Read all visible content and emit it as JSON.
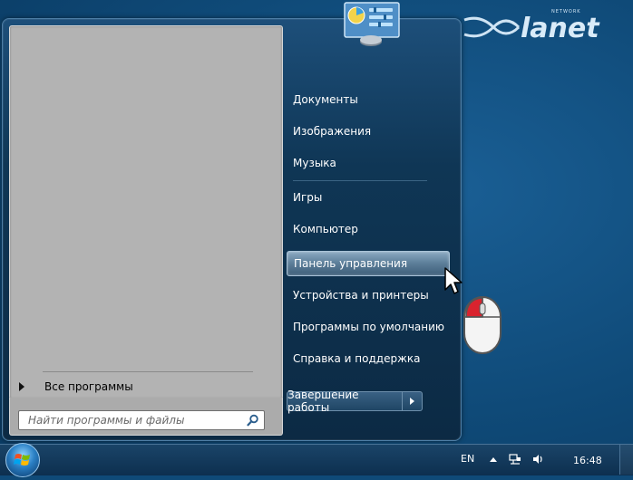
{
  "logo": {
    "text": "lanet",
    "tagline": "NETWORK"
  },
  "start_menu": {
    "all_programs_label": "Все программы",
    "search_placeholder": "Найти программы и файлы",
    "right_items": [
      {
        "label": "Документы"
      },
      {
        "label": "Изображения"
      },
      {
        "label": "Музыка"
      },
      {
        "label": "Игры"
      },
      {
        "label": "Компьютер"
      },
      {
        "label": "Панель управления",
        "highlighted": true
      },
      {
        "label": "Устройства и принтеры"
      },
      {
        "label": "Программы по умолчанию"
      },
      {
        "label": "Справка и поддержка"
      }
    ],
    "shutdown_label": "Завершение работы"
  },
  "taskbar": {
    "language": "EN",
    "clock": "16:48"
  },
  "icons": {
    "start_button": "windows-start-orb",
    "search": "magnifier-icon",
    "control_panel": "control-panel-icon",
    "network": "network-icon",
    "volume": "speaker-icon",
    "mouse_hint": "mouse-left-click-icon"
  },
  "colors": {
    "desktop": "#0f4a78",
    "menu_left_pane": "#b3b3b3",
    "highlight": "#5b7d98",
    "mouse_button_accent": "#d9232e"
  }
}
